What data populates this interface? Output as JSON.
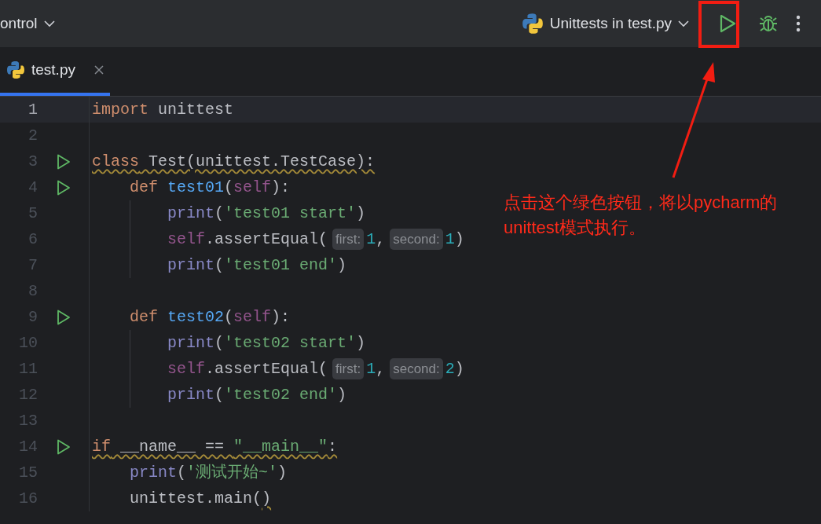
{
  "toolbar": {
    "project_label": "ontrol",
    "run_config": "Unittests in test.py"
  },
  "tabs": [
    {
      "label": "test.py",
      "selected": true
    }
  ],
  "editor": {
    "lines": [
      {
        "number": "1",
        "current": true,
        "run": false,
        "guide": false,
        "tokens": [
          {
            "t": "import",
            "kind": "kw"
          },
          {
            "t": " unittest",
            "kind": "plain"
          }
        ]
      },
      {
        "number": "2",
        "current": false,
        "run": false,
        "guide": false
      },
      {
        "number": "3",
        "current": false,
        "run": true,
        "guide": false,
        "tokens": [
          {
            "t": "class",
            "kind": "kw",
            "warning": true
          },
          {
            "t": " Test(unittest.TestCase):",
            "kind": "plain",
            "warning": true
          }
        ]
      },
      {
        "number": "4",
        "current": false,
        "run": true,
        "guide": false,
        "tokens": [
          {
            "t": "    def",
            "kind": "kw"
          },
          {
            "t": " test01",
            "kind": "func"
          },
          {
            "t": "(",
            "kind": "plain"
          },
          {
            "t": "self",
            "kind": "self"
          },
          {
            "t": "):",
            "kind": "plain"
          }
        ]
      },
      {
        "number": "5",
        "current": false,
        "run": false,
        "guide": true,
        "tokens": [
          {
            "t": "        print",
            "kind": "builtin"
          },
          {
            "t": "(",
            "kind": "plain"
          },
          {
            "t": "'test01 start'",
            "kind": "str"
          },
          {
            "t": ")",
            "kind": "plain"
          }
        ]
      },
      {
        "number": "6",
        "current": false,
        "run": false,
        "guide": true,
        "tokens": [
          {
            "t": "        self",
            "kind": "self"
          },
          {
            "t": ".assertEqual(",
            "kind": "plain"
          },
          {
            "t": "first:",
            "kind": "hint"
          },
          {
            "t": "1",
            "kind": "num"
          },
          {
            "t": ",",
            "kind": "plain"
          },
          {
            "t": "second:",
            "kind": "hint"
          },
          {
            "t": "1",
            "kind": "num"
          },
          {
            "t": ")",
            "kind": "plain"
          }
        ]
      },
      {
        "number": "7",
        "current": false,
        "run": false,
        "guide": true,
        "tokens": [
          {
            "t": "        print",
            "kind": "builtin"
          },
          {
            "t": "(",
            "kind": "plain"
          },
          {
            "t": "'test01 end'",
            "kind": "str"
          },
          {
            "t": ")",
            "kind": "plain"
          }
        ]
      },
      {
        "number": "8",
        "current": false,
        "run": false,
        "guide": false
      },
      {
        "number": "9",
        "current": false,
        "run": true,
        "guide": false,
        "tokens": [
          {
            "t": "    def",
            "kind": "kw"
          },
          {
            "t": " test02",
            "kind": "func"
          },
          {
            "t": "(",
            "kind": "plain"
          },
          {
            "t": "self",
            "kind": "self"
          },
          {
            "t": "):",
            "kind": "plain"
          }
        ]
      },
      {
        "number": "10",
        "current": false,
        "run": false,
        "guide": true,
        "tokens": [
          {
            "t": "        print",
            "kind": "builtin"
          },
          {
            "t": "(",
            "kind": "plain"
          },
          {
            "t": "'test02 start'",
            "kind": "str"
          },
          {
            "t": ")",
            "kind": "plain"
          }
        ]
      },
      {
        "number": "11",
        "current": false,
        "run": false,
        "guide": true,
        "tokens": [
          {
            "t": "        self",
            "kind": "self"
          },
          {
            "t": ".assertEqual(",
            "kind": "plain"
          },
          {
            "t": "first:",
            "kind": "hint"
          },
          {
            "t": "1",
            "kind": "num"
          },
          {
            "t": ",",
            "kind": "plain"
          },
          {
            "t": "second:",
            "kind": "hint"
          },
          {
            "t": "2",
            "kind": "num"
          },
          {
            "t": ")",
            "kind": "plain"
          }
        ]
      },
      {
        "number": "12",
        "current": false,
        "run": false,
        "guide": true,
        "tokens": [
          {
            "t": "        print",
            "kind": "builtin"
          },
          {
            "t": "(",
            "kind": "plain"
          },
          {
            "t": "'test02 end'",
            "kind": "str"
          },
          {
            "t": ")",
            "kind": "plain"
          }
        ]
      },
      {
        "number": "13",
        "current": false,
        "run": false,
        "guide": false
      },
      {
        "number": "14",
        "current": false,
        "run": true,
        "guide": false,
        "tokens": [
          {
            "t": "if",
            "kind": "kw",
            "warning": true
          },
          {
            "t": " __name__ == ",
            "kind": "plain",
            "warning": true
          },
          {
            "t": "\"__main__\"",
            "kind": "str",
            "warning": true
          },
          {
            "t": ":",
            "kind": "plain",
            "warning": true
          }
        ]
      },
      {
        "number": "15",
        "current": false,
        "run": false,
        "guide": false,
        "tokens": [
          {
            "t": "    print",
            "kind": "builtin"
          },
          {
            "t": "(",
            "kind": "plain"
          },
          {
            "t": "'测试开始~'",
            "kind": "str"
          },
          {
            "t": ")",
            "kind": "plain"
          }
        ]
      },
      {
        "number": "16",
        "current": false,
        "run": false,
        "guide": false,
        "tokens": [
          {
            "t": "    unittest.main(",
            "kind": "plain"
          },
          {
            "t": ")",
            "kind": "plain",
            "warning": true
          }
        ]
      }
    ]
  },
  "annotation": {
    "lines": [
      "点击这个绿色按钮，将以pycharm的",
      "unittest模式执行。"
    ]
  }
}
